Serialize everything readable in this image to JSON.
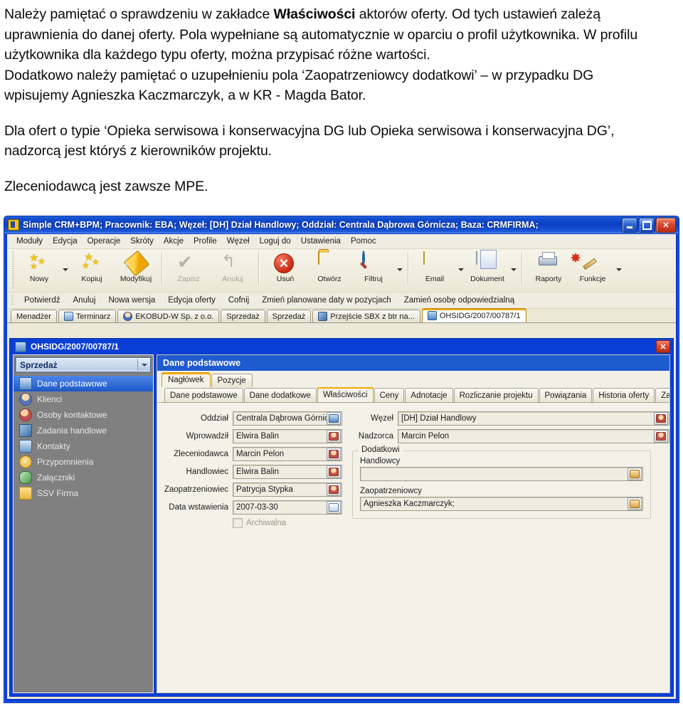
{
  "document": {
    "paragraphs": [
      "Należy pamiętać o sprawdzeniu w zakładce <b>Właściwości</b> aktorów oferty. Od tych ustawień zależą uprawnienia do danej oferty. Pola wypełniane są automatycznie w oparciu o profil użytkownika. W profilu użytkownika dla każdego typu oferty, można przypisać różne wartości.",
      "Dodatkowo należy pamiętać o uzupełnieniu pola ‘Zaopatrzeniowcy dodatkowi’ – w przypadku DG wpisujemy Agnieszka Kaczmarczyk, a w KR - Magda Bator.",
      "Dla ofert o typie ‘Opieka serwisowa i konserwacyjna DG lub Opieka serwisowa i konserwacyjna DG’, nadzorcą jest któryś z kierowników projektu.",
      "Zleceniodawcą jest zawsze MPE."
    ]
  },
  "app": {
    "title": "Simple CRM+BPM; Pracownik: EBA; Węzeł: [DH] Dział Handlowy; Oddział: Centrala Dąbrowa Górnicza; Baza: CRMFIRMA;",
    "window_controls": [
      "minimize",
      "maximize",
      "close"
    ],
    "menu": [
      {
        "label": "Moduły"
      },
      {
        "label": "Edycja"
      },
      {
        "label": "Operacje"
      },
      {
        "label": "Skróty"
      },
      {
        "label": "Akcje"
      },
      {
        "label": "Profile"
      },
      {
        "label": "Węzeł"
      },
      {
        "label": "Loguj do"
      },
      {
        "label": "Ustawienia"
      },
      {
        "label": "Pomoc"
      }
    ],
    "toolbar": [
      {
        "label": "Nowy",
        "icon": "stars-icon",
        "disabled": false,
        "dropdown": true
      },
      {
        "label": "Kopiuj",
        "icon": "stars-icon",
        "disabled": false,
        "dropdown": false
      },
      {
        "label": "Modyfikuj",
        "icon": "pencil-icon",
        "disabled": false,
        "dropdown": false
      },
      {
        "label": "Zapisz",
        "icon": "check-icon",
        "disabled": true,
        "dropdown": false
      },
      {
        "label": "Anuluj",
        "icon": "undo-icon",
        "disabled": true,
        "dropdown": false
      },
      {
        "label": "Usuń",
        "icon": "delete-icon",
        "disabled": false,
        "dropdown": false
      },
      {
        "label": "Otwórz",
        "icon": "folder-icon",
        "disabled": false,
        "dropdown": false
      },
      {
        "label": "Filtruj",
        "icon": "magnifier-icon",
        "disabled": false,
        "dropdown": true
      },
      {
        "label": "Email",
        "icon": "mail-icon",
        "disabled": false,
        "dropdown": true
      },
      {
        "label": "Dokument",
        "icon": "document-icon",
        "disabled": false,
        "dropdown": true
      },
      {
        "label": "Raporty",
        "icon": "printer-icon",
        "disabled": false,
        "dropdown": false
      },
      {
        "label": "Funkcje",
        "icon": "wand-icon",
        "disabled": false,
        "dropdown": true
      }
    ],
    "commandbar": [
      "Potwierdź",
      "Anuluj",
      "Nowa wersja",
      "Edycja oferty",
      "Cofnij",
      "Zmień planowane daty w pozycjach",
      "Zamień osobę odpowiedzialną"
    ],
    "doc_tabs": [
      {
        "label": "Menadżer",
        "icon": "none",
        "active": false
      },
      {
        "label": "Terminarz",
        "icon": "calendar",
        "active": false
      },
      {
        "label": "EKOBUD-W Sp. z o.o.",
        "icon": "person",
        "active": false
      },
      {
        "label": "Sprzedaż",
        "icon": "none",
        "active": false
      },
      {
        "label": "Sprzedaż",
        "icon": "none",
        "active": false
      },
      {
        "label": "Przejście SBX z btr na...",
        "icon": "wrench",
        "active": false
      },
      {
        "label": "OHSIDG/2007/00787/1",
        "icon": "offer",
        "active": true
      }
    ]
  },
  "workspace": {
    "title": "OHSIDG/2007/00787/1",
    "close_label": "✕",
    "sidebar": {
      "combo_value": "Sprzedaż",
      "items": [
        {
          "label": "Dane podstawowe",
          "icon": "document-icon",
          "selected": true
        },
        {
          "label": "Klienci",
          "icon": "user-icon",
          "selected": false
        },
        {
          "label": "Osoby kontaktowe",
          "icon": "users-icon",
          "selected": false
        },
        {
          "label": "Zadania handlowe",
          "icon": "wrench-icon",
          "selected": false
        },
        {
          "label": "Kontakty",
          "icon": "phone-icon",
          "selected": false
        },
        {
          "label": "Przypomnienia",
          "icon": "bell-icon",
          "selected": false
        },
        {
          "label": "Załączniki",
          "icon": "clip-icon",
          "selected": false
        },
        {
          "label": "SSV Firma",
          "icon": "folder-icon",
          "selected": false
        }
      ]
    },
    "panel": {
      "header": "Dane podstawowe",
      "tabs_level1": [
        {
          "label": "Nagłówek",
          "active": true
        },
        {
          "label": "Pozycje",
          "active": false
        }
      ],
      "tabs_level2": [
        {
          "label": "Dane podstawowe",
          "active": false
        },
        {
          "label": "Dane dodatkowe",
          "active": false
        },
        {
          "label": "Właściwości",
          "active": true
        },
        {
          "label": "Ceny",
          "active": false
        },
        {
          "label": "Adnotacje",
          "active": false
        },
        {
          "label": "Rozliczanie projektu",
          "active": false
        },
        {
          "label": "Powiązania",
          "active": false
        },
        {
          "label": "Historia oferty",
          "active": false
        },
        {
          "label": "Zafakturowane pozycje o",
          "active": false
        }
      ],
      "scroll_prev": "‹",
      "scroll_next": "›"
    },
    "form": {
      "left_fields": [
        {
          "label": "Oddział",
          "value": "Centrala Dąbrowa Górnicza",
          "button_icon": "book-icon"
        },
        {
          "label": "Wprowadził",
          "value": "Elwira Balin",
          "button_icon": "person-icon"
        },
        {
          "label": "Zleceniodawca",
          "value": "Marcin Pelon",
          "button_icon": "person-icon"
        },
        {
          "label": "Handlowiec",
          "value": "Elwira Balin",
          "button_icon": "person-icon"
        },
        {
          "label": "Zaopatrzeniowiec",
          "value": "Patrycja Stypka",
          "button_icon": "person-icon"
        },
        {
          "label": "Data wstawienia",
          "value": "2007-03-30",
          "button_icon": "calendar-icon"
        }
      ],
      "checkbox": {
        "label": "Archiwalna",
        "checked": false
      },
      "right_fields": [
        {
          "label": "Węzeł",
          "value": "[DH] Dział Handlowy",
          "button_icon": "node-icon"
        },
        {
          "label": "Nadzorca",
          "value": "Marcin Pelon",
          "button_icon": "person-icon"
        }
      ],
      "fieldset": {
        "legend": "Dodatkowi",
        "rows": [
          {
            "label": "Handlowcy",
            "value": "",
            "button_icon": "group-icon"
          },
          {
            "label": "Zaopatrzeniowcy",
            "value": "Agnieszka Kaczmarczyk;",
            "button_icon": "group-icon"
          }
        ]
      }
    }
  },
  "colors": {
    "window_blue": "#0a3fd6",
    "panel_header_blue": "#1f5bd0",
    "selection_blue": "#1f58c8",
    "tab_accent_orange": "#f3a900",
    "sidebar_gray": "#808080",
    "form_bg": "#f4f2e8"
  }
}
